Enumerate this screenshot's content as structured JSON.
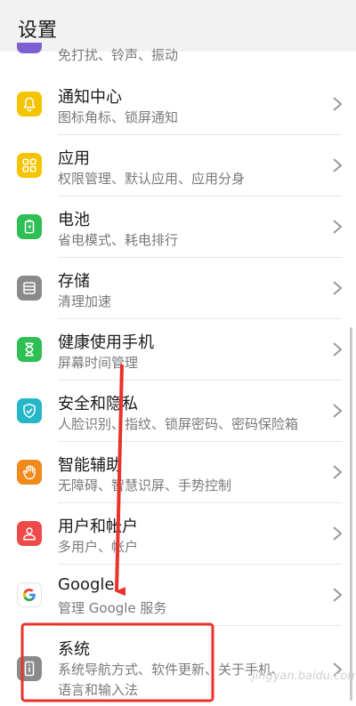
{
  "header": {
    "title": "设置"
  },
  "partial_item": {
    "subtitle": "免打扰、铃声、振动"
  },
  "items": [
    {
      "label": "通知中心",
      "subtitle": "图标角标、锁屏通知",
      "icon": "bell-icon",
      "color": "#f5c400"
    },
    {
      "label": "应用",
      "subtitle": "权限管理、默认应用、应用分身",
      "icon": "apps-grid-icon",
      "color": "#f5c400"
    },
    {
      "label": "电池",
      "subtitle": "省电模式、耗电排行",
      "icon": "battery-icon",
      "color": "#2fbf55"
    },
    {
      "label": "存储",
      "subtitle": "清理加速",
      "icon": "storage-icon",
      "color": "#8a8a8a"
    },
    {
      "label": "健康使用手机",
      "subtitle": "屏幕时间管理",
      "icon": "hourglass-icon",
      "color": "#2fbf55"
    },
    {
      "label": "安全和隐私",
      "subtitle": "人脸识别、指纹、锁屏密码、密码保险箱",
      "icon": "shield-icon",
      "color": "#25b6c8"
    },
    {
      "label": "智能辅助",
      "subtitle": "无障碍、智慧识屏、手势控制",
      "icon": "hand-icon",
      "color": "#f08a1c"
    },
    {
      "label": "用户和帐户",
      "subtitle": "多用户、帐户",
      "icon": "user-icon",
      "color": "#ee4a4a"
    },
    {
      "label": "Google",
      "subtitle": "管理 Google 服务",
      "icon": "google-icon",
      "color": "#ffffff"
    },
    {
      "label": "系统",
      "subtitle": "系统导航方式、软件更新、关于手机、",
      "subtitle2": "语言和输入法",
      "icon": "system-info-icon",
      "color": "#8a8a8a"
    }
  ],
  "watermark": "jingyan.baidu.com",
  "annotation": {
    "arrow_color": "#e8322a",
    "box_color": "#e8322a"
  }
}
